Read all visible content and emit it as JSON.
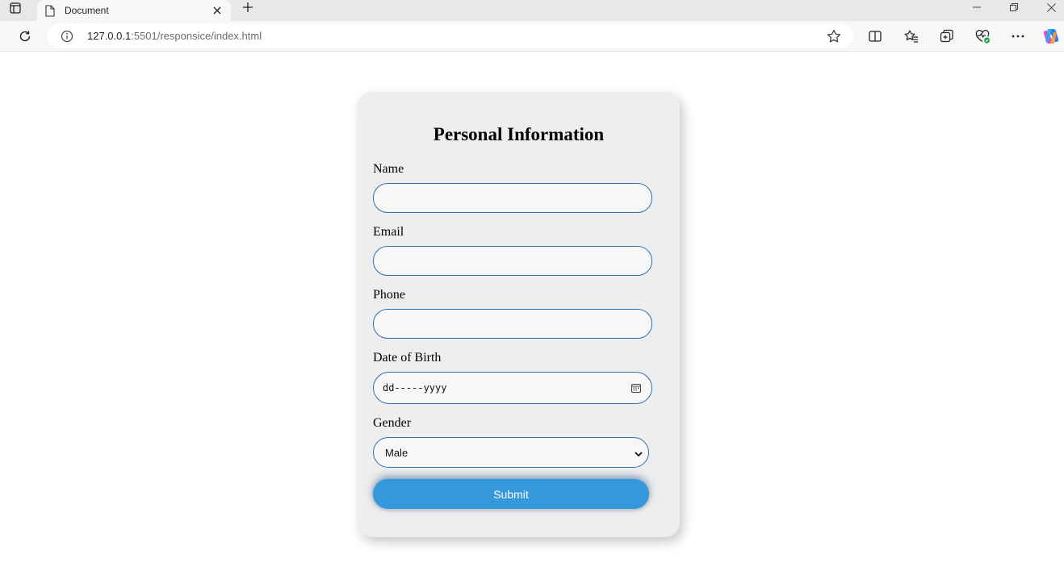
{
  "browser": {
    "tab_title": "Document",
    "url_host": "127.0.0.1",
    "url_rest": ":5501/responsice/index.html",
    "icons": [
      "tab-strip-icon",
      "document-icon",
      "close-icon",
      "plus-icon",
      "minimize-icon",
      "restore-icon",
      "window-close-icon",
      "reload-icon",
      "info-icon",
      "star-icon",
      "split-screen-icon",
      "favorites-icon",
      "collections-icon",
      "browser-essentials-icon",
      "more-icon",
      "copilot-icon"
    ]
  },
  "form": {
    "title": "Personal Information",
    "name_label": "Name",
    "name_value": "",
    "email_label": "Email",
    "email_value": "",
    "phone_label": "Phone",
    "phone_value": "",
    "dob_label": "Date of Birth",
    "dob_placeholder": "dd-----yyyy",
    "gender_label": "Gender",
    "gender_value": "Male",
    "submit_label": "Submit"
  },
  "colors": {
    "accent": "#3498db",
    "input_border": "#2f6fb0",
    "card_bg": "#eeeeee"
  }
}
